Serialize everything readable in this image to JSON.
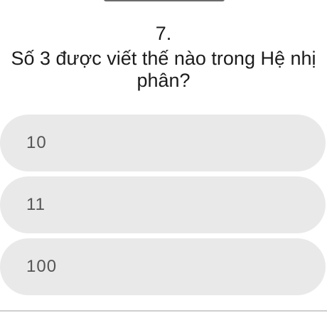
{
  "question": {
    "number": "7.",
    "text": "Số 3 được viết thế nào trong Hệ nhị phân?"
  },
  "options": [
    {
      "label": "10"
    },
    {
      "label": "11"
    },
    {
      "label": "100"
    }
  ],
  "colors": {
    "background": "#ffffff",
    "option_background": "#e9e9e9",
    "text": "#1c1c1c",
    "option_text": "#555555"
  }
}
